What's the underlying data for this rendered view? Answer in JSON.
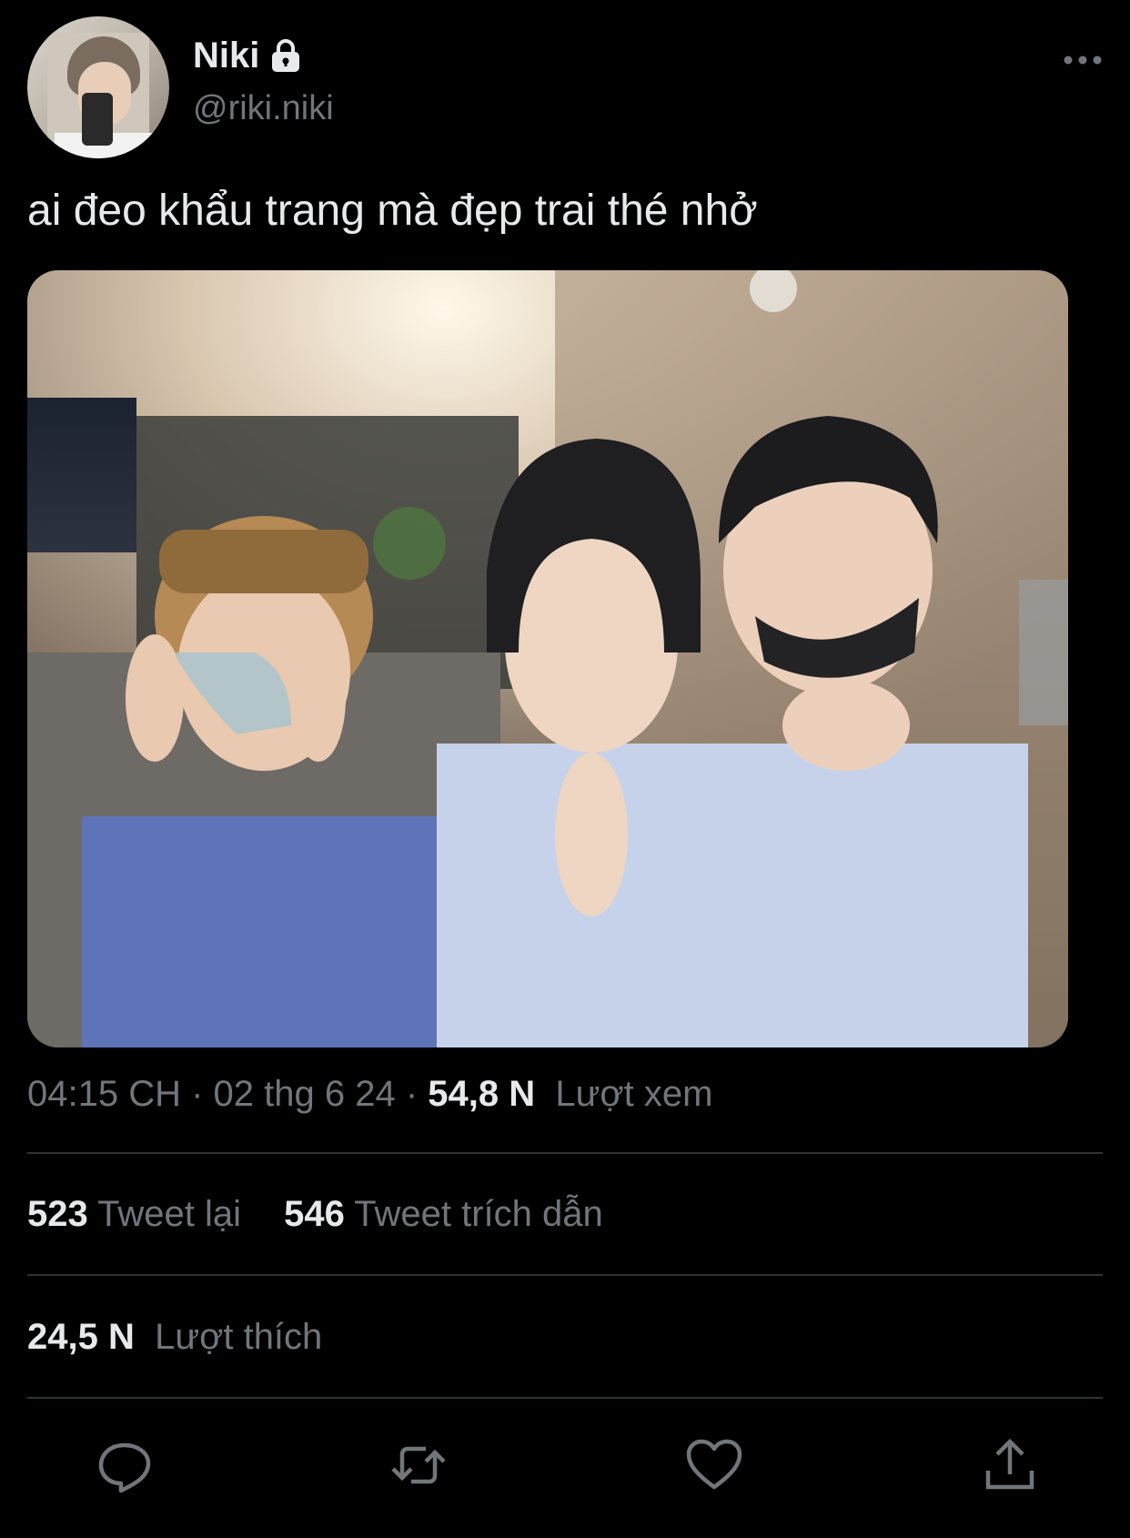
{
  "tweet": {
    "author": {
      "display_name": "Niki",
      "handle": "@riki.niki",
      "avatar_icon": "avatar-photo",
      "protected_icon": "lock-icon"
    },
    "text": "ai đeo khẩu trang mà đẹp trai thé nhở",
    "meta": {
      "time": "04:15 CH",
      "separator": " · ",
      "date": "02 thg 6 24",
      "views_count": "54,8 N",
      "views_label": "Lượt xem"
    },
    "stats": {
      "retweets_count": "523",
      "retweets_label": "Tweet lại",
      "quotes_count": "546",
      "quotes_label": "Tweet trích dẫn",
      "likes_count": "24,5 N",
      "likes_label": "Lượt thích"
    },
    "actions": {
      "reply_icon": "reply-icon",
      "retweet_icon": "retweet-icon",
      "like_icon": "heart-icon",
      "share_icon": "share-icon"
    }
  },
  "colors": {
    "background": "#000000",
    "primary_text": "#e7e9ea",
    "secondary_text": "#71767b",
    "divider": "#2f3336"
  }
}
